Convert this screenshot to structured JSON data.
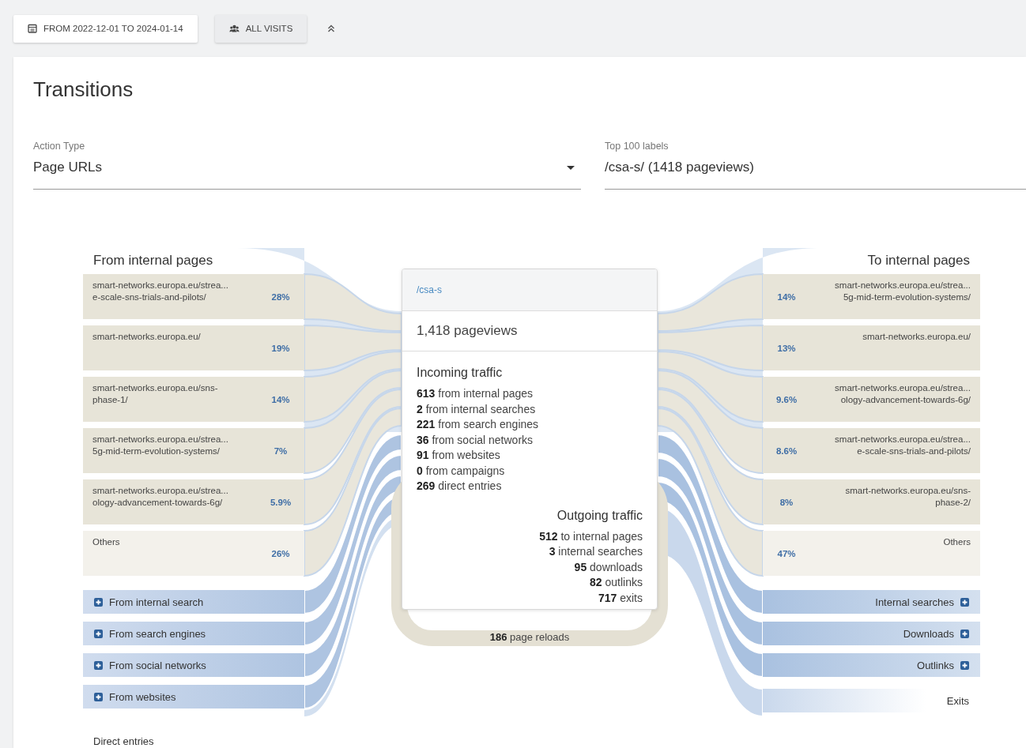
{
  "toolbar": {
    "date_range": "FROM 2022-12-01 TO 2024-01-14",
    "segment": "ALL VISITS"
  },
  "title": "Transitions",
  "action_type": {
    "label": "Action Type",
    "value": "Page URLs"
  },
  "top_labels": {
    "label": "Top 100 labels",
    "value": "/csa-s/ (1418 pageviews)"
  },
  "incoming": {
    "title": "From internal pages",
    "pages": [
      {
        "kind": "page",
        "lines": [
          "smart-networks.europa.eu/strea...",
          "e-scale-sns-trials-and-pilots/"
        ],
        "share": "28%"
      },
      {
        "kind": "page",
        "lines": [
          "smart-networks.europa.eu/"
        ],
        "share": "19%"
      },
      {
        "kind": "page",
        "lines": [
          "smart-networks.europa.eu/sns-",
          "phase-1/"
        ],
        "share": "14%"
      },
      {
        "kind": "page",
        "lines": [
          "smart-networks.europa.eu/strea...",
          "5g-mid-term-evolution-systems/"
        ],
        "share": "7%"
      },
      {
        "kind": "page",
        "lines": [
          "smart-networks.europa.eu/strea...",
          "ology-advancement-towards-6g/"
        ],
        "share": "5.9%"
      },
      {
        "kind": "others",
        "lines": [
          "Others"
        ],
        "share": "26%"
      }
    ],
    "channels": [
      {
        "kind": "expandable",
        "label": "From internal search"
      },
      {
        "kind": "expandable",
        "label": "From search engines"
      },
      {
        "kind": "expandable",
        "label": "From social networks"
      },
      {
        "kind": "expandable",
        "label": "From websites"
      },
      {
        "kind": "plain",
        "label": "Direct entries"
      }
    ]
  },
  "center": {
    "label": "/csa-s",
    "pageviews": "1,418 pageviews",
    "incoming_title": "Incoming traffic",
    "incoming": [
      "**613** from internal pages",
      "**2** from internal searches",
      "**221** from search engines",
      "**36** from social networks",
      "**91** from websites",
      "**0** from campaigns",
      "**269** direct entries"
    ],
    "outgoing_title": "Outgoing traffic",
    "outgoing": [
      "**512** to internal pages",
      "**3** internal searches",
      "**95** downloads",
      "**82** outlinks",
      "**717** exits"
    ],
    "reloads": "**186** page reloads"
  },
  "outgoing": {
    "title": "To internal pages",
    "pages": [
      {
        "kind": "page",
        "lines": [
          "smart-networks.europa.eu/strea...",
          "5g-mid-term-evolution-systems/"
        ],
        "share": "14%"
      },
      {
        "kind": "page",
        "lines": [
          "smart-networks.europa.eu/"
        ],
        "share": "13%"
      },
      {
        "kind": "page",
        "lines": [
          "smart-networks.europa.eu/strea...",
          "ology-advancement-towards-6g/"
        ],
        "share": "9.6%"
      },
      {
        "kind": "page",
        "lines": [
          "smart-networks.europa.eu/strea...",
          "e-scale-sns-trials-and-pilots/"
        ],
        "share": "8.6%"
      },
      {
        "kind": "page",
        "lines": [
          "smart-networks.europa.eu/sns-",
          "phase-2/"
        ],
        "share": "8%"
      },
      {
        "kind": "others",
        "lines": [
          "Others"
        ],
        "share": "47%"
      }
    ],
    "channels": [
      {
        "kind": "expandable",
        "label": "Internal searches"
      },
      {
        "kind": "expandable",
        "label": "Downloads"
      },
      {
        "kind": "expandable",
        "label": "Outlinks"
      },
      {
        "kind": "fading",
        "label": "Exits"
      }
    ]
  }
}
